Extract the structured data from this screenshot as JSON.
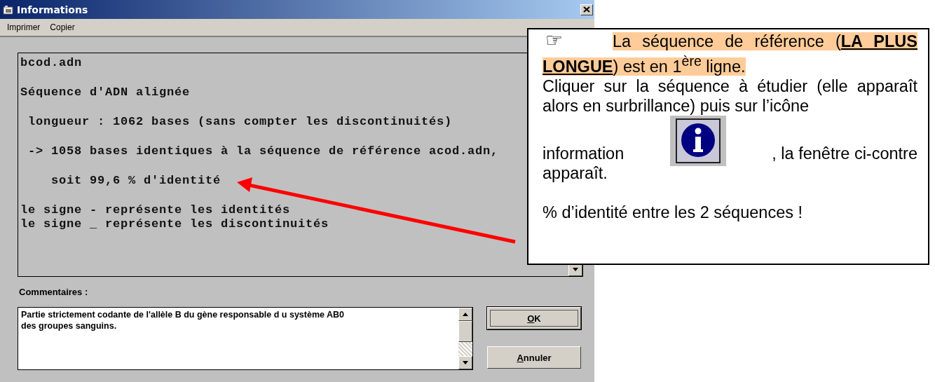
{
  "window": {
    "title": "Informations"
  },
  "menu": [
    {
      "label": "Imprimer"
    },
    {
      "label": "Copier"
    }
  ],
  "info": {
    "blocks": [
      [
        "bcod.adn"
      ],
      [
        "Séquence d'ADN alignée"
      ],
      [
        " longueur : 1062 bases (sans compter les discontinuités)"
      ],
      [
        " -> 1058 bases identiques à la séquence de référence acod.adn,"
      ],
      [
        "    soit 99,6 % d'identité"
      ],
      [
        "le signe - représente les identités",
        "le signe _ représente les discontinuités"
      ]
    ]
  },
  "comments": {
    "label": "Commentaires :",
    "value": "Partie strictement codante de l'allèle B du gène responsable d u système AB0\ndes groupes sanguins."
  },
  "buttons": [
    {
      "label": "OK",
      "default": true
    },
    {
      "label": "Annuler",
      "default": false
    }
  ],
  "callout": {
    "hand": "☞",
    "highlight": "La séquence de référence (**LA PLUS LONGUE**) est en 1$^{ère}$ ligne.",
    "instruction": "Cliquer sur la séquence à étudier (elle apparaît alors en surbrillance) puis sur l’icône",
    "icon_label": "information",
    "after_icon": ", la fenêtre ci-contre",
    "after_end": "apparaît.",
    "note": "% d’identité entre les 2 séquences !"
  }
}
